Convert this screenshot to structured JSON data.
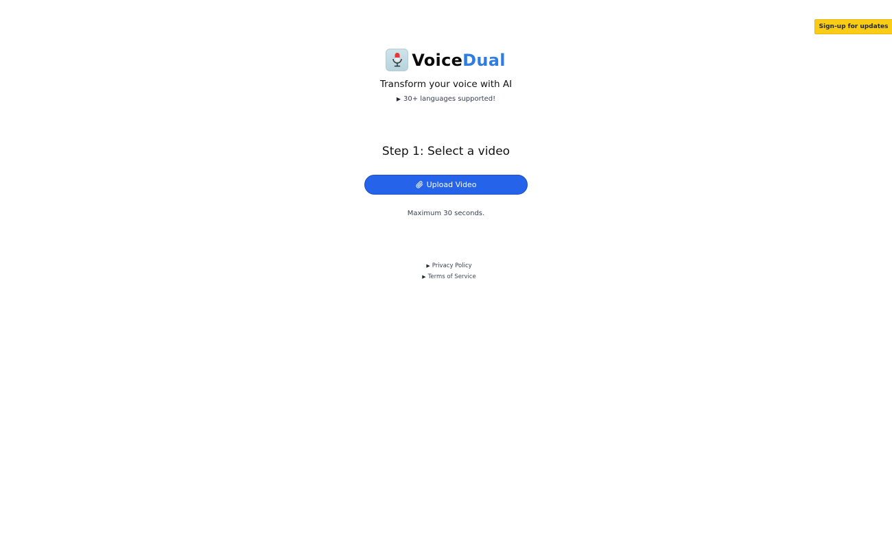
{
  "header": {
    "signup_label": "Sign-up for updates",
    "signup_color": "#facc15"
  },
  "brand": {
    "logo_icon": "microphone-icon",
    "name_part1": "Voice",
    "name_part2": "Dual",
    "accent_color": "#2f7de1"
  },
  "hero": {
    "tagline": "Transform your voice with AI",
    "languages_toggle": "30+ languages supported!"
  },
  "step": {
    "title": "Step 1: Select a video",
    "upload_label": "Upload Video",
    "upload_icon": "paperclip-icon",
    "upload_color": "#2563eb",
    "note": "Maximum 30 seconds."
  },
  "footer": {
    "privacy_label": "Privacy Policy",
    "terms_label": "Terms of Service"
  }
}
